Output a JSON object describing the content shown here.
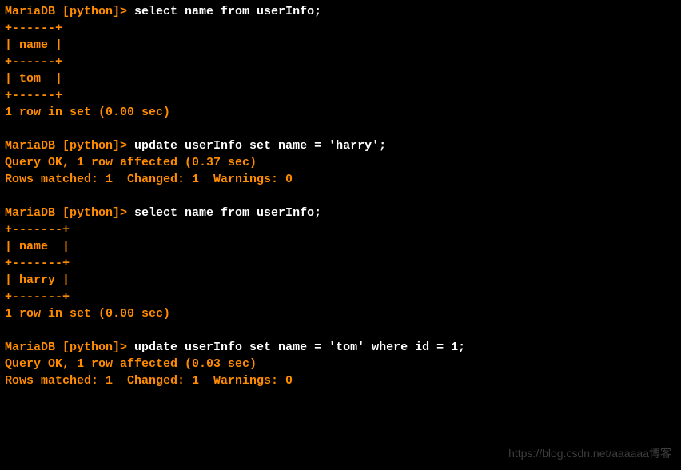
{
  "terminal": {
    "lines": [
      {
        "prompt": "MariaDB [python]> ",
        "command": "select name from userInfo;"
      },
      {
        "result": "+------+"
      },
      {
        "result": "| name |"
      },
      {
        "result": "+------+"
      },
      {
        "result": "| tom  |"
      },
      {
        "result": "+------+"
      },
      {
        "result": "1 row in set (0.00 sec)"
      },
      {
        "result": ""
      },
      {
        "prompt": "MariaDB [python]> ",
        "command": "update userInfo set name = 'harry';"
      },
      {
        "result": "Query OK, 1 row affected (0.37 sec)"
      },
      {
        "result": "Rows matched: 1  Changed: 1  Warnings: 0"
      },
      {
        "result": ""
      },
      {
        "prompt": "MariaDB [python]> ",
        "command": "select name from userInfo;"
      },
      {
        "result": "+-------+"
      },
      {
        "result": "| name  |"
      },
      {
        "result": "+-------+"
      },
      {
        "result": "| harry |"
      },
      {
        "result": "+-------+"
      },
      {
        "result": "1 row in set (0.00 sec)"
      },
      {
        "result": ""
      },
      {
        "prompt": "MariaDB [python]> ",
        "command": "update userInfo set name = 'tom' where id = 1;"
      },
      {
        "result": "Query OK, 1 row affected (0.03 sec)"
      },
      {
        "result": "Rows matched: 1  Changed: 1  Warnings: 0"
      }
    ]
  },
  "watermark": "https://blog.csdn.net/aaaaaa博客"
}
